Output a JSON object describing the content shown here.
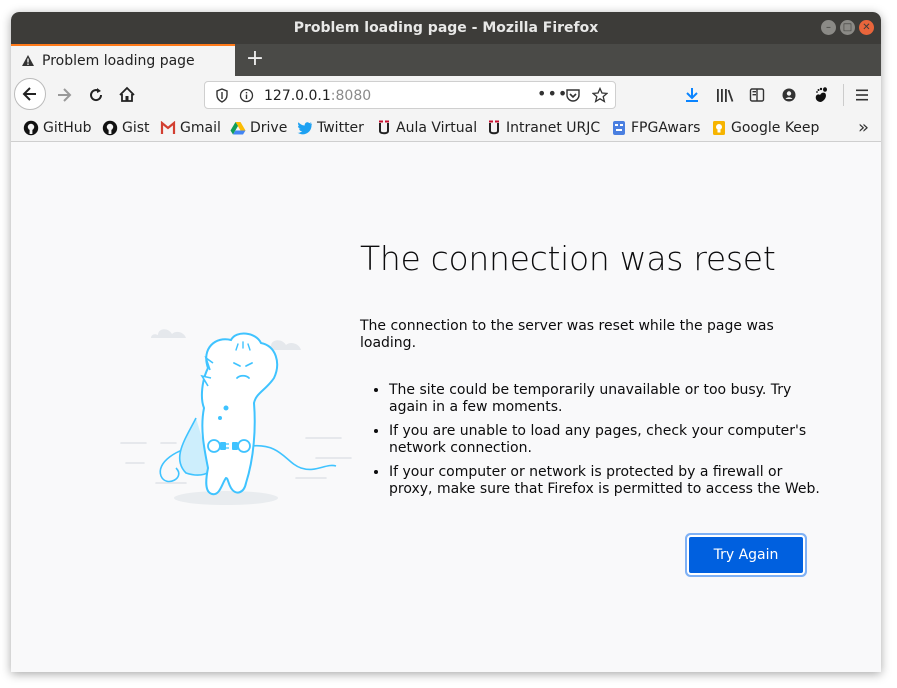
{
  "window": {
    "title": "Problem loading page - Mozilla Firefox"
  },
  "tab": {
    "label": "Problem loading page"
  },
  "urlbar": {
    "host": "127.0.0.1",
    "port": ":8080"
  },
  "bookmarks": [
    {
      "label": "GitHub",
      "icon": "github-icon"
    },
    {
      "label": "Gist",
      "icon": "github-icon"
    },
    {
      "label": "Gmail",
      "icon": "gmail-icon"
    },
    {
      "label": "Drive",
      "icon": "drive-icon"
    },
    {
      "label": "Twitter",
      "icon": "twitter-icon"
    },
    {
      "label": "Aula Virtual",
      "icon": "urjc-icon"
    },
    {
      "label": "Intranet URJC",
      "icon": "urjc-icon"
    },
    {
      "label": "FPGAwars",
      "icon": "fpgawars-icon"
    },
    {
      "label": "Google Keep",
      "icon": "keep-icon"
    }
  ],
  "error": {
    "heading": "The connection was reset",
    "description": "The connection to the server was reset while the page was loading.",
    "reasons": [
      "The site could be temporarily unavailable or too busy. Try again in a few moments.",
      "If you are unable to load any pages, check your computer's network connection.",
      "If your computer or network is protected by a firewall or proxy, make sure that Firefox is permitted to access the Web."
    ],
    "button": "Try Again"
  },
  "colors": {
    "accent": "#0060df",
    "tab_highlight": "#ff7a1a",
    "illustration": "#3fc3ff"
  }
}
